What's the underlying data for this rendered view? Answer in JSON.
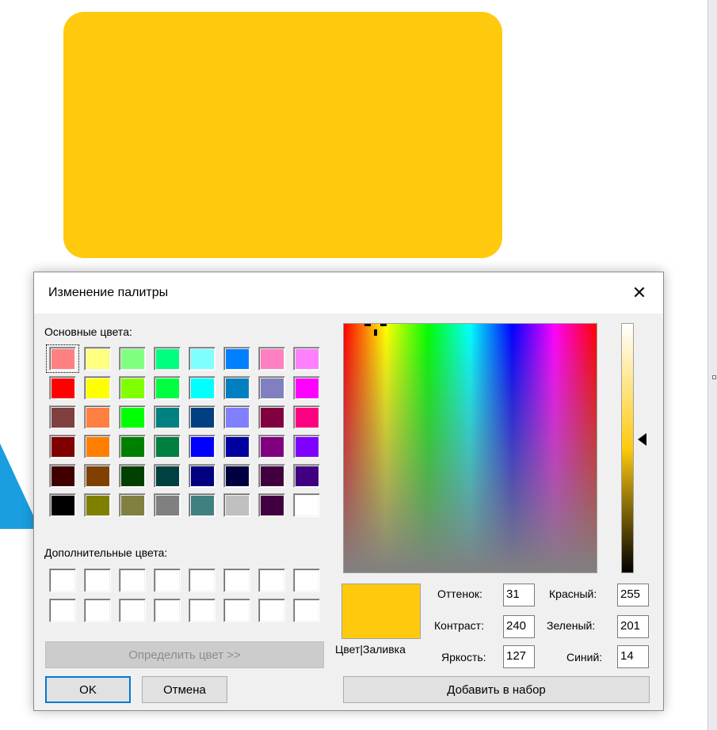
{
  "colors": {
    "selected": "#ffca0e",
    "background_blue": "#1a9ee0",
    "focus_blue": "#0078d7"
  },
  "dialog": {
    "title": "Изменение палитры",
    "close_label": "✕",
    "basic_colors_label": "Основные цвета:",
    "custom_colors_label": "Дополнительные цвета:",
    "define_button": "Определить цвет >>",
    "ok_button": "OK",
    "cancel_button": "Отмена",
    "add_button": "Добавить в набор",
    "preview_label": "Цвет|Заливка",
    "hue_label": "Оттенок:",
    "hue_value": "31",
    "sat_label": "Контраст:",
    "sat_value": "240",
    "lum_label": "Яркость:",
    "lum_value": "127",
    "red_label": "Красный:",
    "red_value": "255",
    "green_label": "Зеленый:",
    "green_value": "201",
    "blue_label": "Синий:",
    "blue_value": "14"
  },
  "basic_colors": [
    [
      "#ff8080",
      "#ffff80",
      "#80ff80",
      "#00ff80",
      "#80ffff",
      "#0080ff",
      "#ff80c0",
      "#ff80ff"
    ],
    [
      "#ff0000",
      "#ffff00",
      "#80ff00",
      "#00ff40",
      "#00ffff",
      "#0080c0",
      "#8080c0",
      "#ff00ff"
    ],
    [
      "#804040",
      "#ff8040",
      "#00ff00",
      "#008080",
      "#004080",
      "#8080ff",
      "#800040",
      "#ff0080"
    ],
    [
      "#800000",
      "#ff8000",
      "#008000",
      "#008040",
      "#0000ff",
      "#0000a0",
      "#800080",
      "#8000ff"
    ],
    [
      "#400000",
      "#804000",
      "#004000",
      "#004040",
      "#000080",
      "#000040",
      "#400040",
      "#400080"
    ],
    [
      "#000000",
      "#808000",
      "#808040",
      "#808080",
      "#408080",
      "#c0c0c0",
      "#400040",
      "#ffffff"
    ]
  ],
  "custom_colors": [
    [
      "#ffffff",
      "#ffffff",
      "#ffffff",
      "#ffffff",
      "#ffffff",
      "#ffffff",
      "#ffffff",
      "#ffffff"
    ],
    [
      "#ffffff",
      "#ffffff",
      "#ffffff",
      "#ffffff",
      "#ffffff",
      "#ffffff",
      "#ffffff",
      "#ffffff"
    ]
  ]
}
